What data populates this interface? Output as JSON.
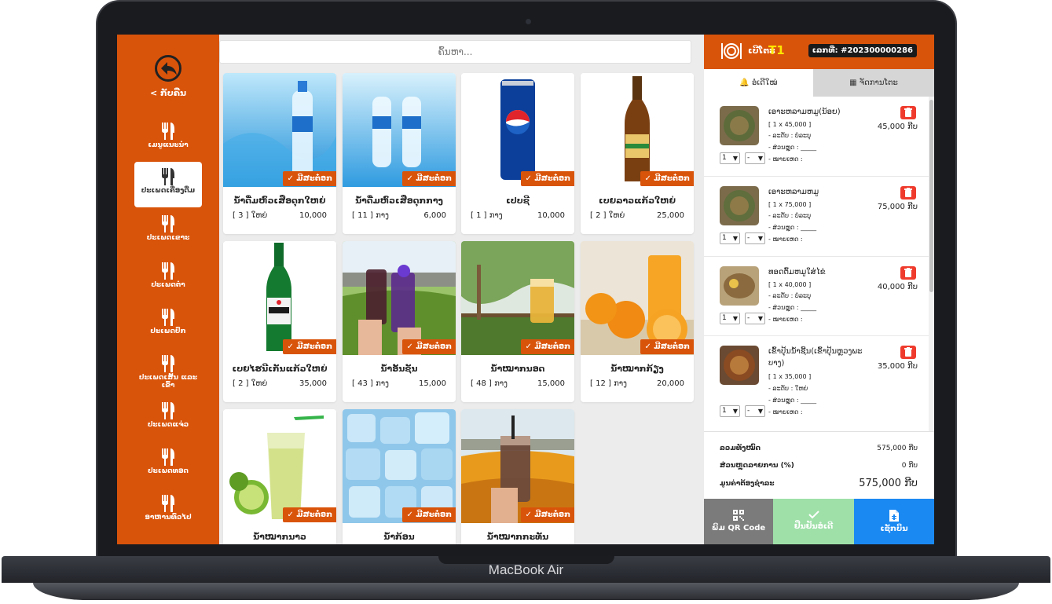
{
  "device": {
    "brand": "MacBook Air"
  },
  "sidebar": {
    "back_label": "< ກັບຄືນ",
    "categories": [
      {
        "label": "ເມນູແນະນຳ"
      },
      {
        "label": "ປະເພດເຄື່ອງດື່ມ"
      },
      {
        "label": "ປະເພດເຂາະ"
      },
      {
        "label": "ປະເພດຕຳ"
      },
      {
        "label": "ປະເພດປົກ"
      },
      {
        "label": "ປະເພດເສັ້ນ ແລະ ເຂົ້າ"
      },
      {
        "label": "ປະເພດແຈ່ວ"
      },
      {
        "label": "ປະເພດທອດ"
      },
      {
        "label": "ອາຫານທົ່ວໄປ"
      }
    ]
  },
  "search": {
    "placeholder": "ຄົ້ນຫາ..."
  },
  "products": [
    {
      "name": "ນ້ຳດື່ມຫົວເສືອດຸກໃຫຍ່",
      "qty": "[ 3 ] ໃຫຍ່",
      "price": "10,000",
      "badge": "✓ ມີສະຕ໋ອກ"
    },
    {
      "name": "ນ້ຳດື່ມຫົວເສືອດຸກກາງ",
      "qty": "[ 11 ] ກາງ",
      "price": "6,000",
      "badge": "✓ ມີສະຕ໋ອກ"
    },
    {
      "name": "ເປບຊີ",
      "qty": "[ 1 ] ກາງ",
      "price": "10,000",
      "badge": "✓ ມີສະຕ໋ອກ"
    },
    {
      "name": "ເບຍລາວແກ້ວໃຫຍ່",
      "qty": "[ 2 ] ໃຫຍ່",
      "price": "25,000",
      "badge": "✓ ມີສະຕ໋ອກ"
    },
    {
      "name": "ເບຍໄຮນີເກັນແກ້ວໃຫຍ່",
      "qty": "[ 2 ] ໃຫຍ່",
      "price": "35,000",
      "badge": "✓ ມີສະຕ໋ອກ"
    },
    {
      "name": "ນ້ຳອັນຊັນ",
      "qty": "[ 43 ] ກາງ",
      "price": "15,000",
      "badge": "✓ ມີສະຕ໋ອກ"
    },
    {
      "name": "ນ້ຳໝາກນອດ",
      "qty": "[ 48 ] ກາງ",
      "price": "15,000",
      "badge": "✓ ມີສະຕ໋ອກ"
    },
    {
      "name": "ນ້ຳໝາກກ້ຽງ",
      "qty": "[ 12 ] ກາງ",
      "price": "20,000",
      "badge": "✓ ມີສະຕ໋ອກ"
    },
    {
      "name": "ນ້ຳໝາກນາວ",
      "qty": "",
      "price": "",
      "badge": "✓ ມີສະຕ໋ອກ"
    },
    {
      "name": "ນ້ຳກ້ອນ",
      "qty": "",
      "price": "",
      "badge": "✓ ມີສະຕ໋ອກ"
    },
    {
      "name": "ນ້ຳໝາກກະທັນ",
      "qty": "",
      "price": "",
      "badge": "✓ ມີສະຕ໋ອກ"
    }
  ],
  "panel": {
    "table_label": "ເບີໂຕະ",
    "table_value": "T1",
    "bill_number": "ເລກທີ່: #202300000286",
    "tabs": {
      "new_order": "ອໍເດີໃໝ່",
      "manage_table": "ຈັດການໂຕະ"
    },
    "orders": [
      {
        "name": "ເອາະຫລາມຫມູ(ນ້ອຍ)",
        "qty_line": "[ 1 x 45,000 ]",
        "level_line": "- ລະດັບ : ບໍ່ລະບຸ",
        "discount_line": "- ສ່ວນຫຼຸດ : _____",
        "note_line": "- ໝາຍເຫດ :",
        "price": "45,000 ກີບ",
        "qty": "1",
        "opt": "-"
      },
      {
        "name": "ເອາະຫລາມຫມູ",
        "qty_line": "[ 1 x 75,000 ]",
        "level_line": "- ລະດັບ : ບໍ່ລະບຸ",
        "discount_line": "- ສ່ວນຫຼຸດ : _____",
        "note_line": "- ໝາຍເຫດ :",
        "price": "75,000 ກີບ",
        "qty": "1",
        "opt": "-"
      },
      {
        "name": "ທອດຕົ້ມຫມູໃສ່ໄຂ່",
        "qty_line": "[ 1 x 40,000 ]",
        "level_line": "- ລະດັບ : ບໍ່ລະບຸ",
        "discount_line": "- ສ່ວນຫຼຸດ : _____",
        "note_line": "- ໝາຍເຫດ :",
        "price": "40,000 ກີບ",
        "qty": "1",
        "opt": "-"
      },
      {
        "name": "ເຂົ້າປຸ້ນນ້ຳຊີ້ນ(ເຂົ້າປຸ້ນຫຼວງພະບາງ)",
        "qty_line": "[ 1 x 35,000 ]",
        "level_line": "- ລະດັບ : ໃຫຍ່",
        "discount_line": "- ສ່ວນຫຼຸດ : _____",
        "note_line": "- ໝາຍເຫດ :",
        "price": "35,000 ກີບ",
        "qty": "1",
        "opt": "-"
      }
    ],
    "totals": {
      "subtotal_label": "ລວມທັງໝົດ",
      "subtotal_value": "575,000 ກີບ",
      "discount_label": "ສ່ວນຫຼຸດລາຍການ (%)",
      "discount_value": "0 ກີບ",
      "grand_label": "ມູນຄ່າຕ້ອງຊຳລະ",
      "grand_value": "575,000 ກີບ"
    },
    "buttons": {
      "qr": "ພິມ QR Code",
      "confirm": "ຢືນຢັນອໍເດີ",
      "print": "ເຊັກບິນ"
    }
  },
  "colors": {
    "accent": "#d9540b",
    "stock_badge": "#d9540b",
    "delete": "#ef3b2d",
    "confirm": "#9fe0a9",
    "print": "#1b89f2",
    "qr": "#7b7b7b",
    "table_value": "#ffe600"
  }
}
